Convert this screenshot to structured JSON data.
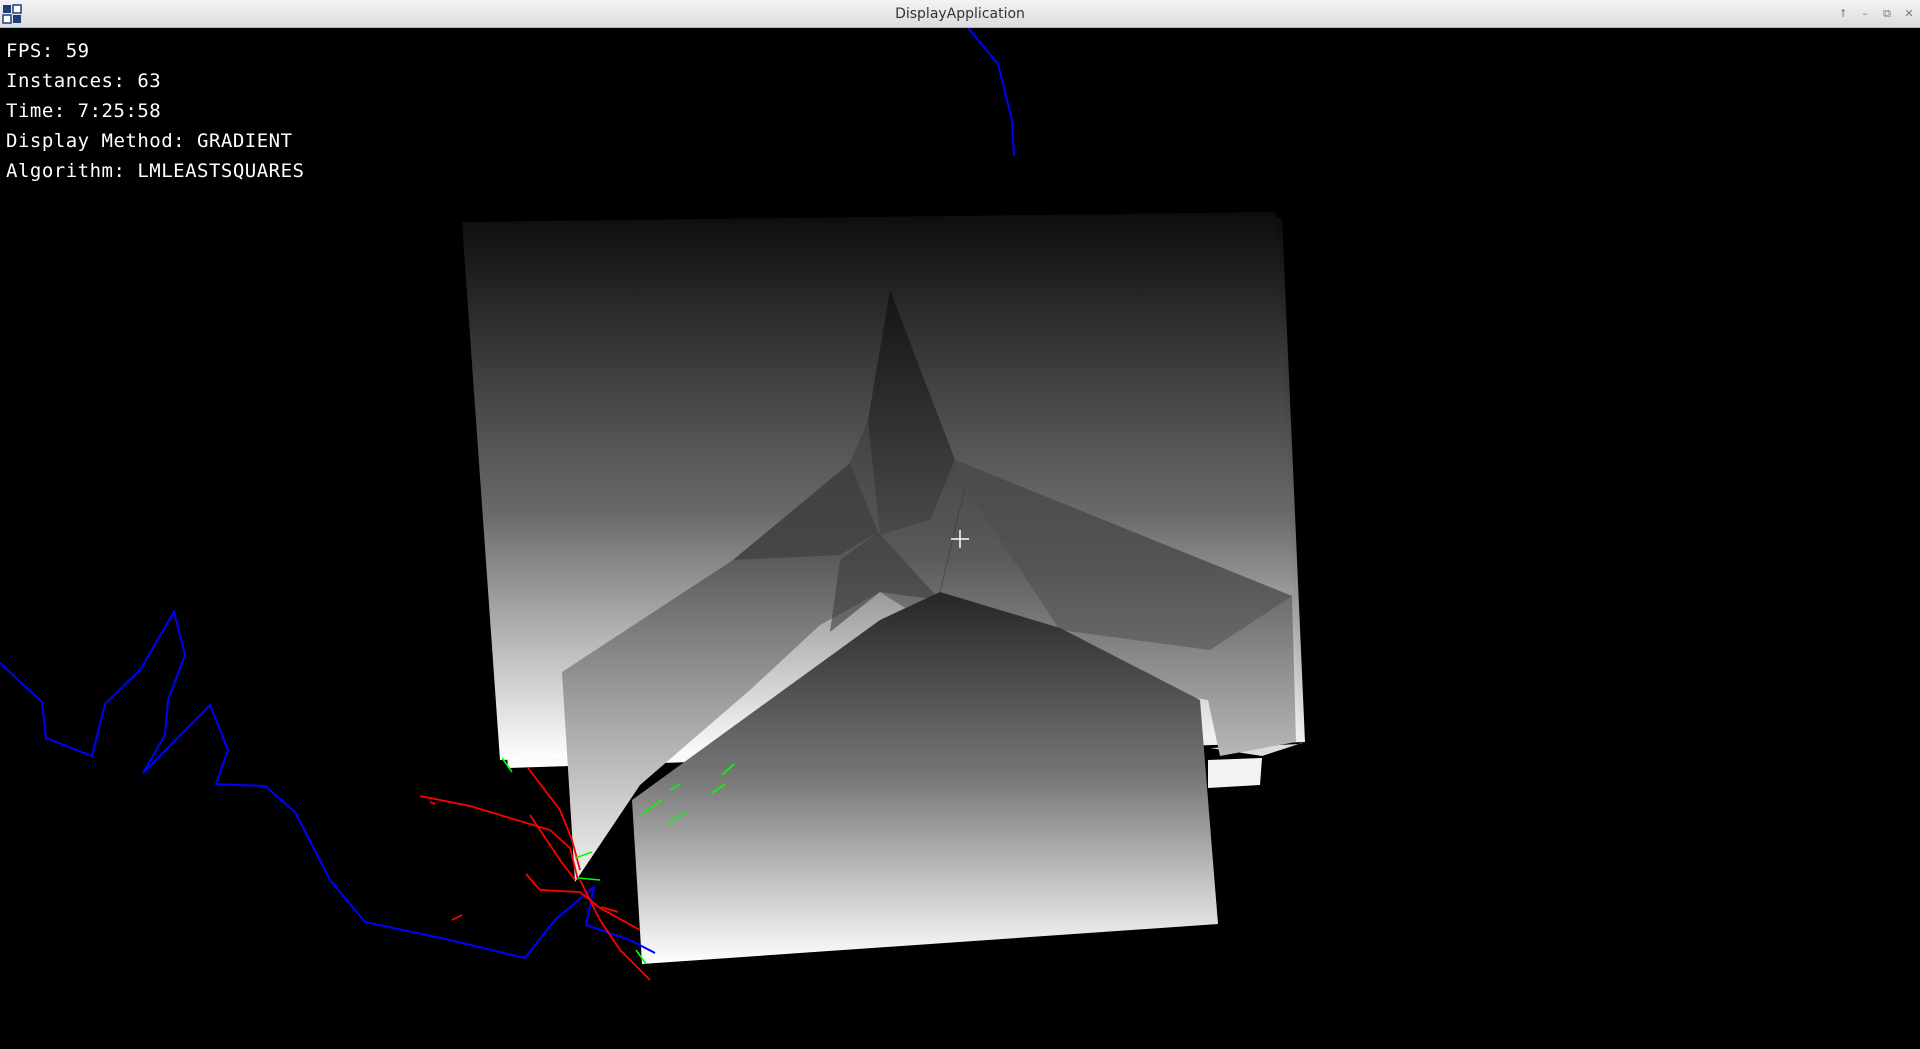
{
  "window": {
    "title": "DisplayApplication",
    "buttons": [
      "up-arrow-icon",
      "minimize-icon",
      "restore-icon",
      "close-icon"
    ]
  },
  "hud": {
    "fps": "FPS: 59",
    "instances": "Instances: 63",
    "time": "Time: 7:25:58",
    "display_method": "Display Method: GRADIENT",
    "algorithm": "Algorithm: LMLEASTSQUARES"
  },
  "scene": {
    "background": "#000000",
    "surface_gradient": [
      "#161616",
      "#ffffff"
    ],
    "colors": {
      "blue_path": "#0000ff",
      "red_lines": "#ff0000",
      "green_marks": "#00ff00",
      "crosshair": "#ffffff"
    }
  }
}
